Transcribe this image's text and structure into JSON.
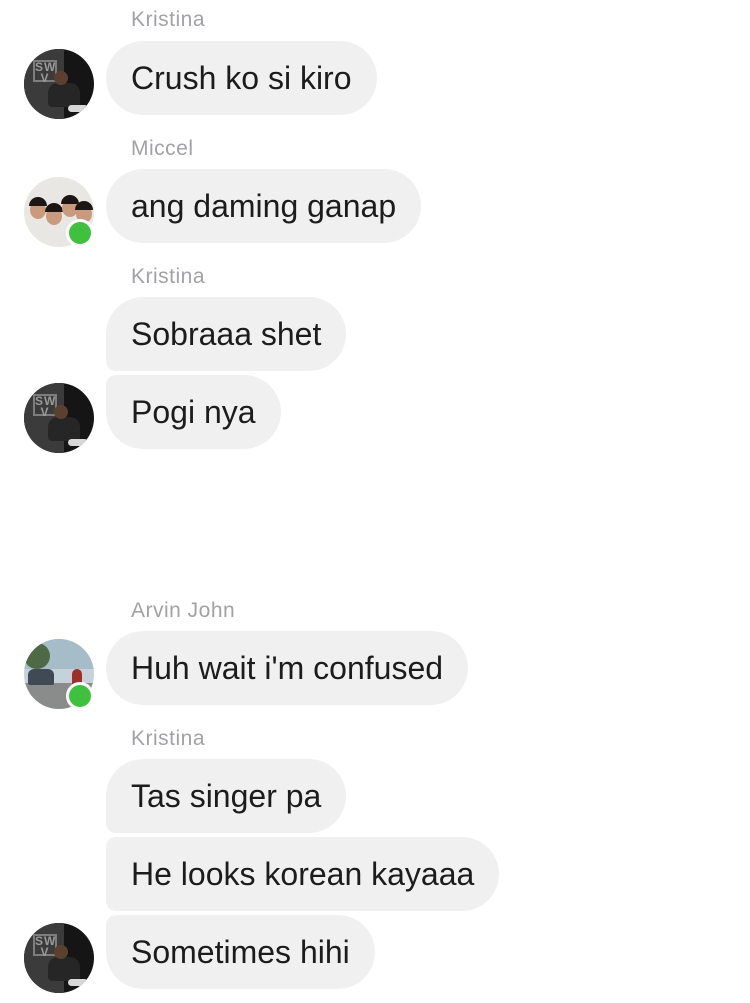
{
  "colors": {
    "bubble_background": "#f1f0f0",
    "sender_name": "#a2a2a6",
    "message_text": "#1c1c1c",
    "online_indicator": "#3fc13f"
  },
  "messages": [
    {
      "sender": "Kristina",
      "text": "Crush ko si kiro"
    },
    {
      "sender": "Miccel",
      "text": "ang daming ganap"
    },
    {
      "sender": "Kristina",
      "text": "Sobraaa shet"
    },
    {
      "sender": "",
      "text": "Pogi nya"
    },
    {
      "sender": "Arvin John",
      "text": "Huh wait i'm confused"
    },
    {
      "sender": "Kristina",
      "text": "Tas singer pa"
    },
    {
      "sender": "",
      "text": "He looks korean kayaaa"
    },
    {
      "sender": "",
      "text": "Sometimes hihi"
    }
  ],
  "avatars": [
    {
      "person": "Kristina",
      "icon": "profile-photo",
      "online": false
    },
    {
      "person": "Miccel",
      "icon": "group-selfie-photo",
      "online": true
    },
    {
      "person": "Kristina",
      "icon": "profile-photo",
      "online": false
    },
    {
      "person": "Arvin John",
      "icon": "street-photo",
      "online": true
    },
    {
      "person": "Kristina",
      "icon": "profile-photo",
      "online": false
    }
  ]
}
